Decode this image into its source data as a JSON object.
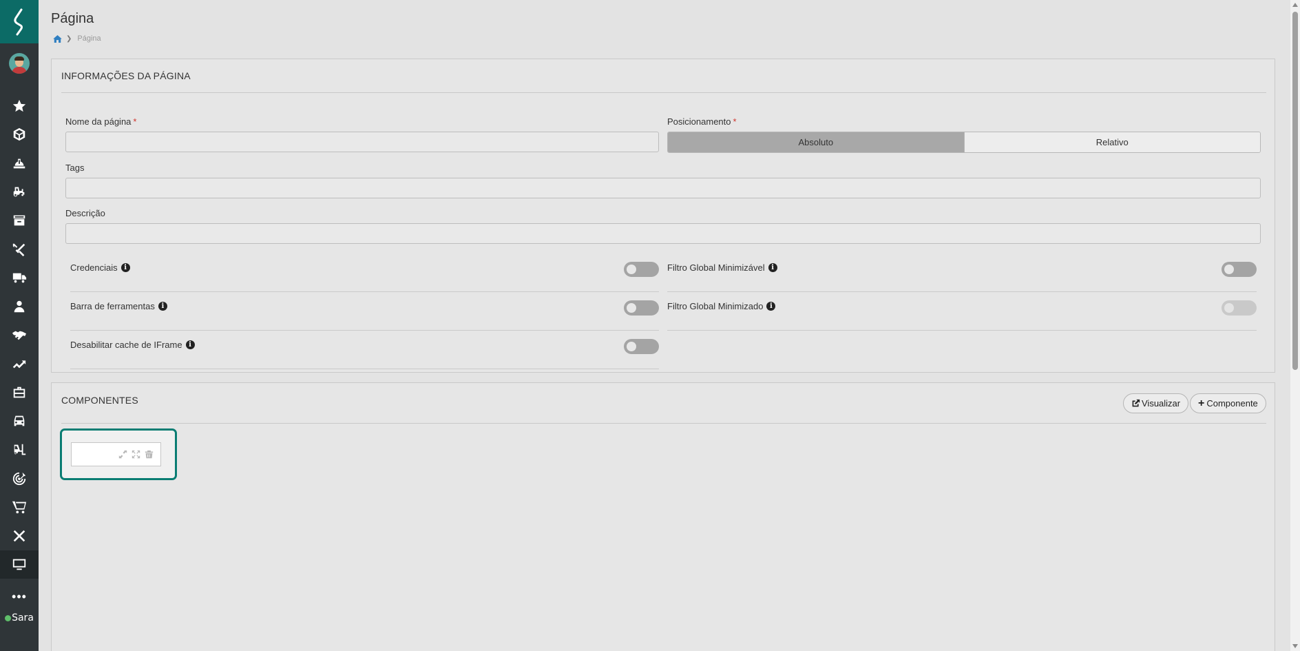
{
  "header": {
    "title": "Página",
    "breadcrumb_current": "Página"
  },
  "sidebar": {
    "items": [
      {
        "icon": "star-icon"
      },
      {
        "icon": "cube-icon"
      },
      {
        "icon": "hard-hat-icon"
      },
      {
        "icon": "tractor-icon"
      },
      {
        "icon": "archive-icon"
      },
      {
        "icon": "tools-icon"
      },
      {
        "icon": "truck-icon"
      },
      {
        "icon": "people-icon"
      },
      {
        "icon": "handshake-icon"
      },
      {
        "icon": "trend-up-icon"
      },
      {
        "icon": "briefcase-icon"
      },
      {
        "icon": "vehicle-icon"
      },
      {
        "icon": "forklift-icon"
      },
      {
        "icon": "target-icon"
      },
      {
        "icon": "cart-icon"
      },
      {
        "icon": "x-icon"
      },
      {
        "icon": "monitor-icon"
      }
    ],
    "more": "•••",
    "assistant": "Sara"
  },
  "info_panel": {
    "title": "INFORMAÇÕES DA PÁGINA",
    "page_name": {
      "label": "Nome da página",
      "required_mark": "*",
      "value": ""
    },
    "positioning": {
      "label": "Posicionamento",
      "required_mark": "*",
      "options": [
        "Absoluto",
        "Relativo"
      ],
      "selected": "Absoluto"
    },
    "tags": {
      "label": "Tags",
      "value": ""
    },
    "description": {
      "label": "Descrição",
      "value": ""
    },
    "toggles": {
      "credentials": {
        "label": "Credenciais",
        "on": false
      },
      "toolbar": {
        "label": "Barra de ferramentas",
        "on": false
      },
      "iframe_cache": {
        "label": "Desabilitar cache de IFrame",
        "on": false
      },
      "global_filter_minimizable": {
        "label": "Filtro Global Minimizável",
        "on": false
      },
      "global_filter_minimized": {
        "label": "Filtro Global Minimizado",
        "on": false,
        "disabled": true
      }
    }
  },
  "components_panel": {
    "title": "COMPONENTES",
    "preview_button": "Visualizar",
    "add_button": "Componente",
    "add_button_prefix": "+"
  },
  "colors": {
    "brand_teal": "#0c6b66",
    "sidebar_bg": "#2f3538",
    "component_border": "#0a7d73",
    "required": "#d0342c",
    "home_link": "#2f7fc1"
  }
}
